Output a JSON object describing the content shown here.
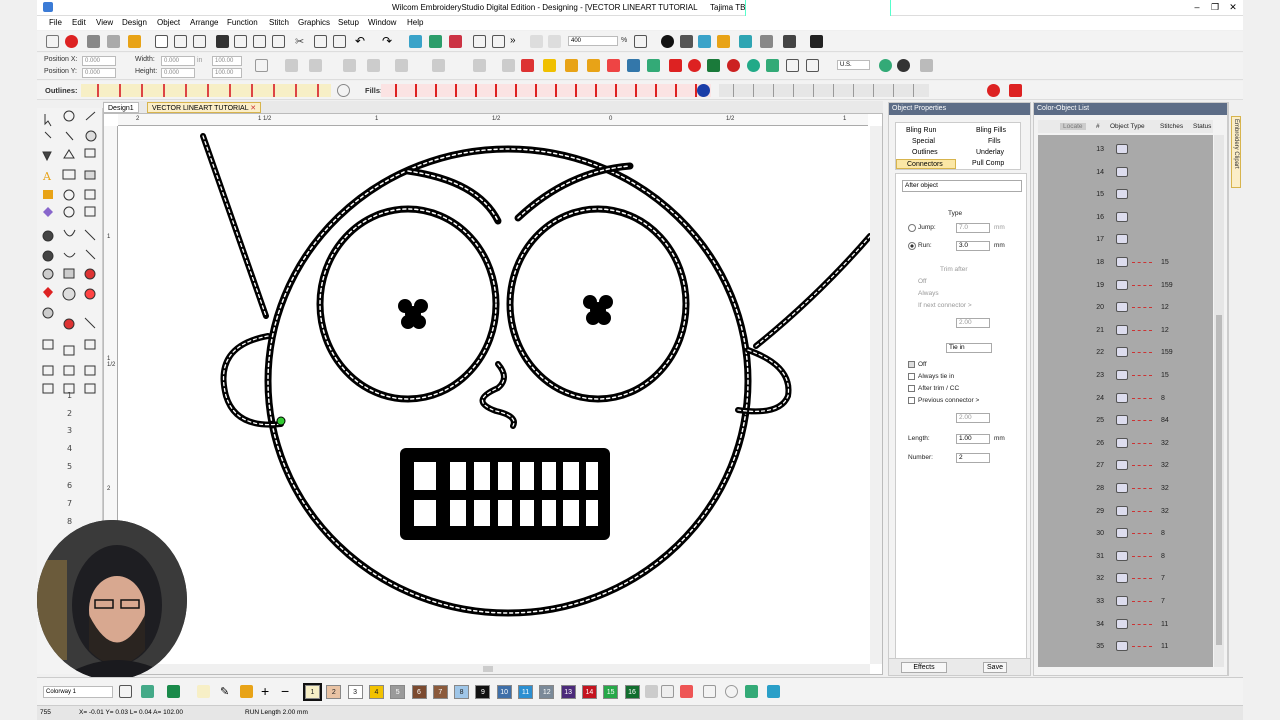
{
  "window": {
    "title": "Wilcom EmbroideryStudio Digital Edition - Designing - [VECTOR LINEART TUTORIAL",
    "machine": "Tajima TBF]"
  },
  "menu": [
    "File",
    "Edit",
    "View",
    "Design",
    "Object",
    "Arrange",
    "Function",
    "Stitch",
    "Graphics",
    "Setup",
    "Window",
    "Help"
  ],
  "toolbar": {
    "zoom": "400",
    "zoom_unit": "%",
    "units": "U.S.",
    "position_x_label": "Position X:",
    "position_y_label": "Position Y:",
    "position_x": "0.000",
    "position_y": "0.000",
    "width_label": "Width:",
    "height_label": "Height:",
    "width": "0.000",
    "height": "0.000",
    "unit_in": "in",
    "scale_w": "100.00",
    "scale_h": "100.00",
    "outlines_label": "Outlines:",
    "fills_label": "Fills:"
  },
  "tabs": [
    "Design1",
    "VECTOR LINEART TUTORIAL"
  ],
  "ruler_top": [
    "2",
    "1 1/2",
    "1",
    "1/2",
    "0",
    "1/2",
    "1"
  ],
  "ruler_left": [
    "1",
    "1 1/2",
    "2",
    "3"
  ],
  "object_properties": {
    "title": "Object Properties",
    "tabs": [
      "Bling Run",
      "Bling Fills",
      "Special",
      "Fills",
      "Outlines",
      "Underlay",
      "Connectors",
      "Pull Comp"
    ],
    "dropdown": "After object",
    "type_label": "Type",
    "jump_label": "Jump:",
    "jump_value": "7.0",
    "run_label": "Run:",
    "run_value": "3.0",
    "unit_mm": "mm",
    "trim_after": "Trim after",
    "trim_off": "Off",
    "trim_always": "Always",
    "trim_next": "If next connector >",
    "trim_value": "2.00",
    "tie_in": "Tie in",
    "tie_off": "Off",
    "always_tie_in": "Always tie in",
    "after_trim": "After trim / CC",
    "previous_connector": "Previous connector >",
    "prev_value": "2.00",
    "length_label": "Length:",
    "length_value": "1.00",
    "number_label": "Number:",
    "number_value": "2",
    "effects": "Effects",
    "save": "Save"
  },
  "color_list": {
    "title": "Color-Object List",
    "headers": [
      "Locate",
      "#",
      "Object Type",
      "Stitches",
      "Status"
    ],
    "rows": [
      {
        "n": "13",
        "s": ""
      },
      {
        "n": "14",
        "s": ""
      },
      {
        "n": "15",
        "s": ""
      },
      {
        "n": "16",
        "s": ""
      },
      {
        "n": "17",
        "s": ""
      },
      {
        "n": "18",
        "s": "15"
      },
      {
        "n": "19",
        "s": "159"
      },
      {
        "n": "20",
        "s": "12"
      },
      {
        "n": "21",
        "s": "12"
      },
      {
        "n": "22",
        "s": "159"
      },
      {
        "n": "23",
        "s": "15"
      },
      {
        "n": "24",
        "s": "8"
      },
      {
        "n": "25",
        "s": "84"
      },
      {
        "n": "26",
        "s": "32"
      },
      {
        "n": "27",
        "s": "32"
      },
      {
        "n": "28",
        "s": "32"
      },
      {
        "n": "29",
        "s": "32"
      },
      {
        "n": "30",
        "s": "8"
      },
      {
        "n": "31",
        "s": "8"
      },
      {
        "n": "32",
        "s": "7"
      },
      {
        "n": "33",
        "s": "7"
      },
      {
        "n": "34",
        "s": "11"
      },
      {
        "n": "35",
        "s": "11"
      }
    ],
    "side_tab": "Embroidery Clipart"
  },
  "bottom": {
    "colorway": "Colorway 1",
    "swatches": [
      {
        "n": "1",
        "c": "#f7efc6"
      },
      {
        "n": "2",
        "c": "#e9c3a4"
      },
      {
        "n": "3",
        "c": "#ffffff"
      },
      {
        "n": "4",
        "c": "#f2c200"
      },
      {
        "n": "5",
        "c": "#9a9a9a"
      },
      {
        "n": "6",
        "c": "#7b4a2f"
      },
      {
        "n": "7",
        "c": "#8b5a3b"
      },
      {
        "n": "8",
        "c": "#9fc6e8"
      },
      {
        "n": "9",
        "c": "#111111"
      },
      {
        "n": "10",
        "c": "#3e6fa8"
      },
      {
        "n": "11",
        "c": "#2c8fd1"
      },
      {
        "n": "12",
        "c": "#7b8a99"
      },
      {
        "n": "13",
        "c": "#4b2a7a"
      },
      {
        "n": "14",
        "c": "#c4141f"
      },
      {
        "n": "15",
        "c": "#27a849"
      },
      {
        "n": "16",
        "c": "#116d2e"
      }
    ]
  },
  "status": {
    "left": "755",
    "coords": "X=   -0.01 Y=  0.03 L=  0.04 A= 102.00",
    "run_length": "RUN Length  2.00 mm"
  },
  "colors": {
    "panel_header": "#5d6d87",
    "accent": "#e8a317"
  }
}
